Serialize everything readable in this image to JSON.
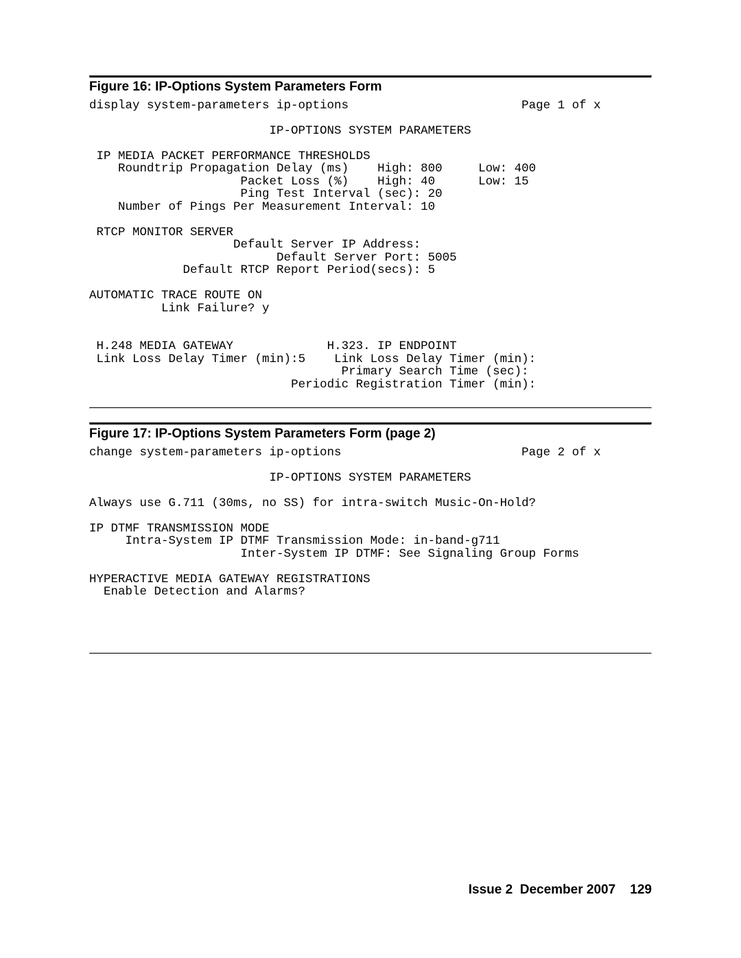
{
  "figure16": {
    "caption": "Figure 16: IP-Options System Parameters Form",
    "cmd": "display system-parameters ip-options",
    "page": "Page 1 of x",
    "title": "IP-OPTIONS SYSTEM PARAMETERS",
    "thresholds": {
      "heading": "IP MEDIA PACKET PERFORMANCE THRESHOLDS",
      "roundtrip_label": "Roundtrip Propagation Delay (ms)",
      "roundtrip_high": "High: 800",
      "roundtrip_low": "Low: 400",
      "packetloss_label": "Packet Loss (%)",
      "packetloss_high": "High: 40",
      "packetloss_low": "Low: 15",
      "ping_interval": "Ping Test Interval (sec): 20",
      "pings_per_interval": "Number of Pings Per Measurement Interval: 10"
    },
    "rtcp": {
      "heading": "RTCP MONITOR SERVER",
      "server_ip": "Default Server IP Address:",
      "server_port": "Default Server Port: 5005",
      "report_period": "Default RTCP Report Period(secs): 5"
    },
    "trace": {
      "heading": "AUTOMATIC TRACE ROUTE ON",
      "link_failure": "Link Failure? y"
    },
    "h248": {
      "heading": "H.248 MEDIA GATEWAY",
      "link_loss": "Link Loss Delay Timer (min):5"
    },
    "h323": {
      "heading": "H.323. IP ENDPOINT",
      "link_loss": "Link Loss Delay Timer (min):",
      "primary_search": "Primary Search Time (sec):",
      "periodic_reg": "Periodic Registration Timer (min):"
    }
  },
  "figure17": {
    "caption": "Figure 17: IP-Options System Parameters Form (page 2)",
    "cmd": "change system-parameters ip-options",
    "page": "Page 2 of x",
    "title": "IP-OPTIONS SYSTEM PARAMETERS",
    "moh": "Always use G.711 (30ms, no SS) for intra-switch Music-On-Hold?",
    "dtmf": {
      "heading": "IP DTMF TRANSMISSION MODE",
      "intra": "Intra-System IP DTMF Transmission Mode: in-band-g711",
      "inter": "Inter-System IP DTMF: See Signaling Group Forms"
    },
    "hyper": {
      "heading": "HYPERACTIVE MEDIA GATEWAY REGISTRATIONS",
      "enable": "Enable Detection and Alarms?"
    }
  },
  "footer": {
    "issue": "Issue 2",
    "date": "December 2007",
    "page": "129"
  }
}
